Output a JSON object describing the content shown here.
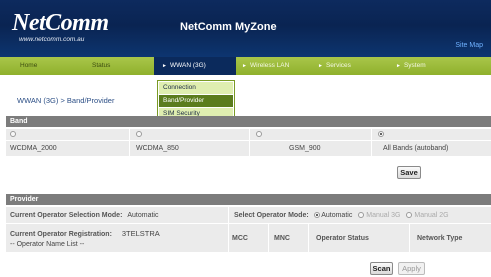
{
  "header": {
    "logo_text": "NetComm",
    "logo_url": "www.netcomm.com.au",
    "title": "NetComm MyZone",
    "site_map": "Site Map"
  },
  "nav": {
    "items": [
      {
        "label": "Home"
      },
      {
        "label": "Status"
      },
      {
        "label": "WWAN (3G)"
      },
      {
        "label": "Wireless LAN"
      },
      {
        "label": "Services"
      },
      {
        "label": "System"
      }
    ],
    "active": "WWAN (3G)"
  },
  "dropdown": {
    "items": [
      {
        "label": "Connection"
      },
      {
        "label": "Band/Provider"
      },
      {
        "label": "SIM Security"
      }
    ],
    "active": "Band/Provider"
  },
  "breadcrumb": "WWAN (3G) > Band/Provider",
  "band": {
    "section_title": "Band",
    "options": [
      {
        "label": "WCDMA_2000",
        "selected": false
      },
      {
        "label": "WCDMA_850",
        "selected": false
      },
      {
        "label": "GSM_900",
        "selected": false
      },
      {
        "label": "All Bands (autoband)",
        "selected": true
      }
    ],
    "save_label": "Save"
  },
  "provider": {
    "section_title": "Provider",
    "selection_mode_label": "Current Operator Selection Mode:",
    "selection_mode_value": "Automatic",
    "select_mode_label": "Select Operator Mode:",
    "mode_options": [
      {
        "label": "Automatic",
        "selected": true
      },
      {
        "label": "Manual 3G",
        "selected": false
      },
      {
        "label": "Manual 2G",
        "selected": false
      }
    ],
    "registration_label": "Current Operator Registration:",
    "registration_value": "3TELSTRA",
    "operator_list_label": "-- Operator Name List --",
    "columns": [
      "MCC",
      "MNC",
      "Operator Status",
      "Network Type"
    ],
    "scan_label": "Scan",
    "apply_label": "Apply"
  }
}
